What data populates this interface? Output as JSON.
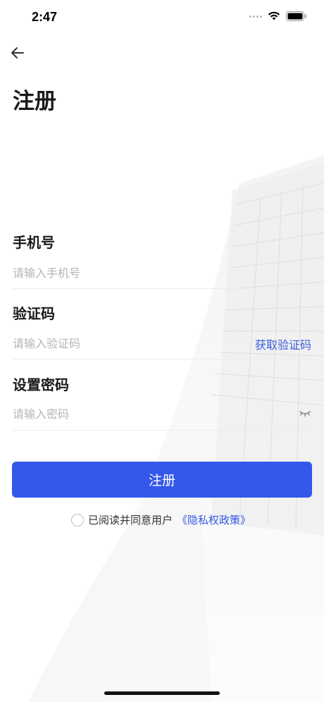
{
  "status_bar": {
    "time": "2:47",
    "icons": [
      "cellular-dots-icon",
      "wifi-icon",
      "battery-icon"
    ]
  },
  "nav": {
    "back_icon": "arrow-left-icon"
  },
  "page": {
    "title": "注册"
  },
  "form": {
    "phone": {
      "label": "手机号",
      "placeholder": "请输入手机号",
      "value": ""
    },
    "code": {
      "label": "验证码",
      "placeholder": "请输入验证码",
      "value": "",
      "get_code_label": "获取验证码"
    },
    "password": {
      "label": "设置密码",
      "placeholder": "请输入密码",
      "value": "",
      "toggle_icon": "eye-closed-icon"
    }
  },
  "actions": {
    "register_label": "注册"
  },
  "agreement": {
    "checked": false,
    "text": "已阅读并同意用户",
    "link_text": "《隐私权政策》"
  },
  "colors": {
    "primary": "#3458ea",
    "placeholder": "#b5b5b5",
    "divider": "#ececec"
  }
}
